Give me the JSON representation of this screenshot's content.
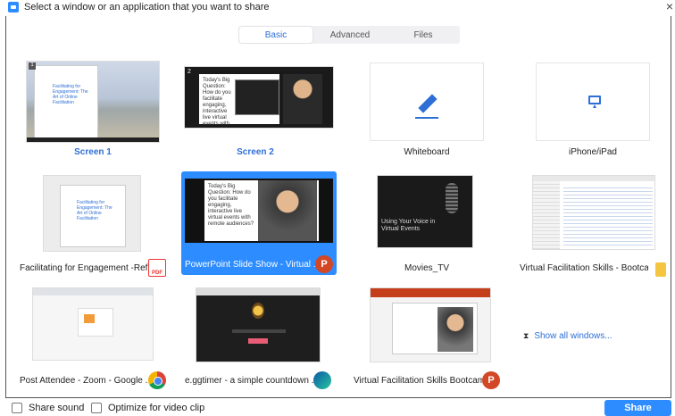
{
  "window": {
    "title": "Select a window or an application that you want to share",
    "close_glyph": "×"
  },
  "tabs": [
    {
      "label": "Basic",
      "active": true
    },
    {
      "label": "Advanced",
      "active": false
    },
    {
      "label": "Files",
      "active": false
    }
  ],
  "tiles": [
    {
      "label": "Screen 1",
      "thumb_text": "Facilitating for Engagement: The Art of Online Facilitation",
      "number": "1"
    },
    {
      "label": "Screen 2",
      "thumb_text": "Today's Big Question: How do you facilitate engaging, interactive live virtual events with remote audiences?",
      "number": "2"
    },
    {
      "label": "Whiteboard",
      "icon": "pencil-icon"
    },
    {
      "label": "iPhone/iPad",
      "icon": "airplay-icon"
    },
    {
      "label": "Facilitating for Engagement -Ref...",
      "thumb_text": "Facilitating for Engagement: The Art of Online Facilitation",
      "app_icon": "pdf-icon",
      "app_icon_text": "PDF"
    },
    {
      "label": "PowerPoint Slide Show - Virtual ...",
      "thumb_text": "Today's Big Question: How do you facilitate engaging, interactive live virtual events with remote audiences?",
      "app_icon": "powerpoint-icon",
      "app_icon_text": "P"
    },
    {
      "label": "Movies_TV",
      "thumb_text": "Using Your Voice in Virtual Events"
    },
    {
      "label": "Virtual Facilitation Skills - Bootca...",
      "app_icon": "folder-icon"
    },
    {
      "label": "Post Attendee - Zoom - Google ...",
      "app_icon": "chrome-icon"
    },
    {
      "label": "e.ggtimer - a simple countdown ...",
      "app_icon": "edge-icon"
    },
    {
      "label": "Virtual Facilitation Skills Bootcam...",
      "app_icon": "powerpoint-icon",
      "app_icon_text": "P"
    }
  ],
  "show_all": {
    "label": "Show all windows..."
  },
  "options": {
    "share_sound": {
      "label": "Share sound",
      "checked": false
    },
    "optimize_video": {
      "label": "Optimize for video clip",
      "checked": false
    }
  },
  "share_button": {
    "label": "Share"
  },
  "colors": {
    "accent": "#2d8cff",
    "link": "#2d6fd6"
  }
}
